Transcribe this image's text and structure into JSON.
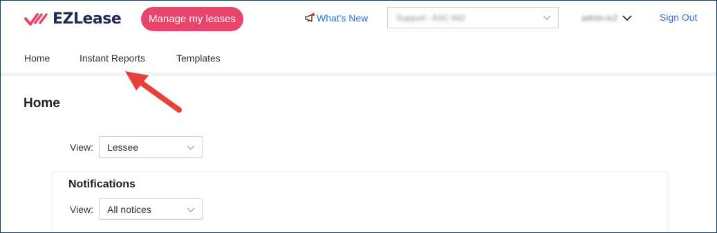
{
  "header": {
    "logo_text": "EZLease",
    "manage_button": "Manage my leases",
    "whats_new": "What's New",
    "org_select_value": "Support - ASC 842",
    "user_name": "admin-lc2",
    "sign_out": "Sign Out"
  },
  "tabs": [
    {
      "label": "Home",
      "active": true
    },
    {
      "label": "Instant Reports",
      "active": false
    },
    {
      "label": "Templates",
      "active": false
    }
  ],
  "main": {
    "title": "Home",
    "view_label": "View:",
    "view_value": "Lessee",
    "notifications": {
      "title": "Notifications",
      "view_label": "View:",
      "view_value": "All notices"
    }
  },
  "colors": {
    "brand_navy": "#1f2a55",
    "brand_pink": "#e9456a",
    "link_blue": "#2f6fc9",
    "annotation_red": "#e8403a"
  },
  "icons": [
    "logo-checkmark-icon",
    "megaphone-icon",
    "chevron-down-icon",
    "annotation-arrow-icon"
  ]
}
